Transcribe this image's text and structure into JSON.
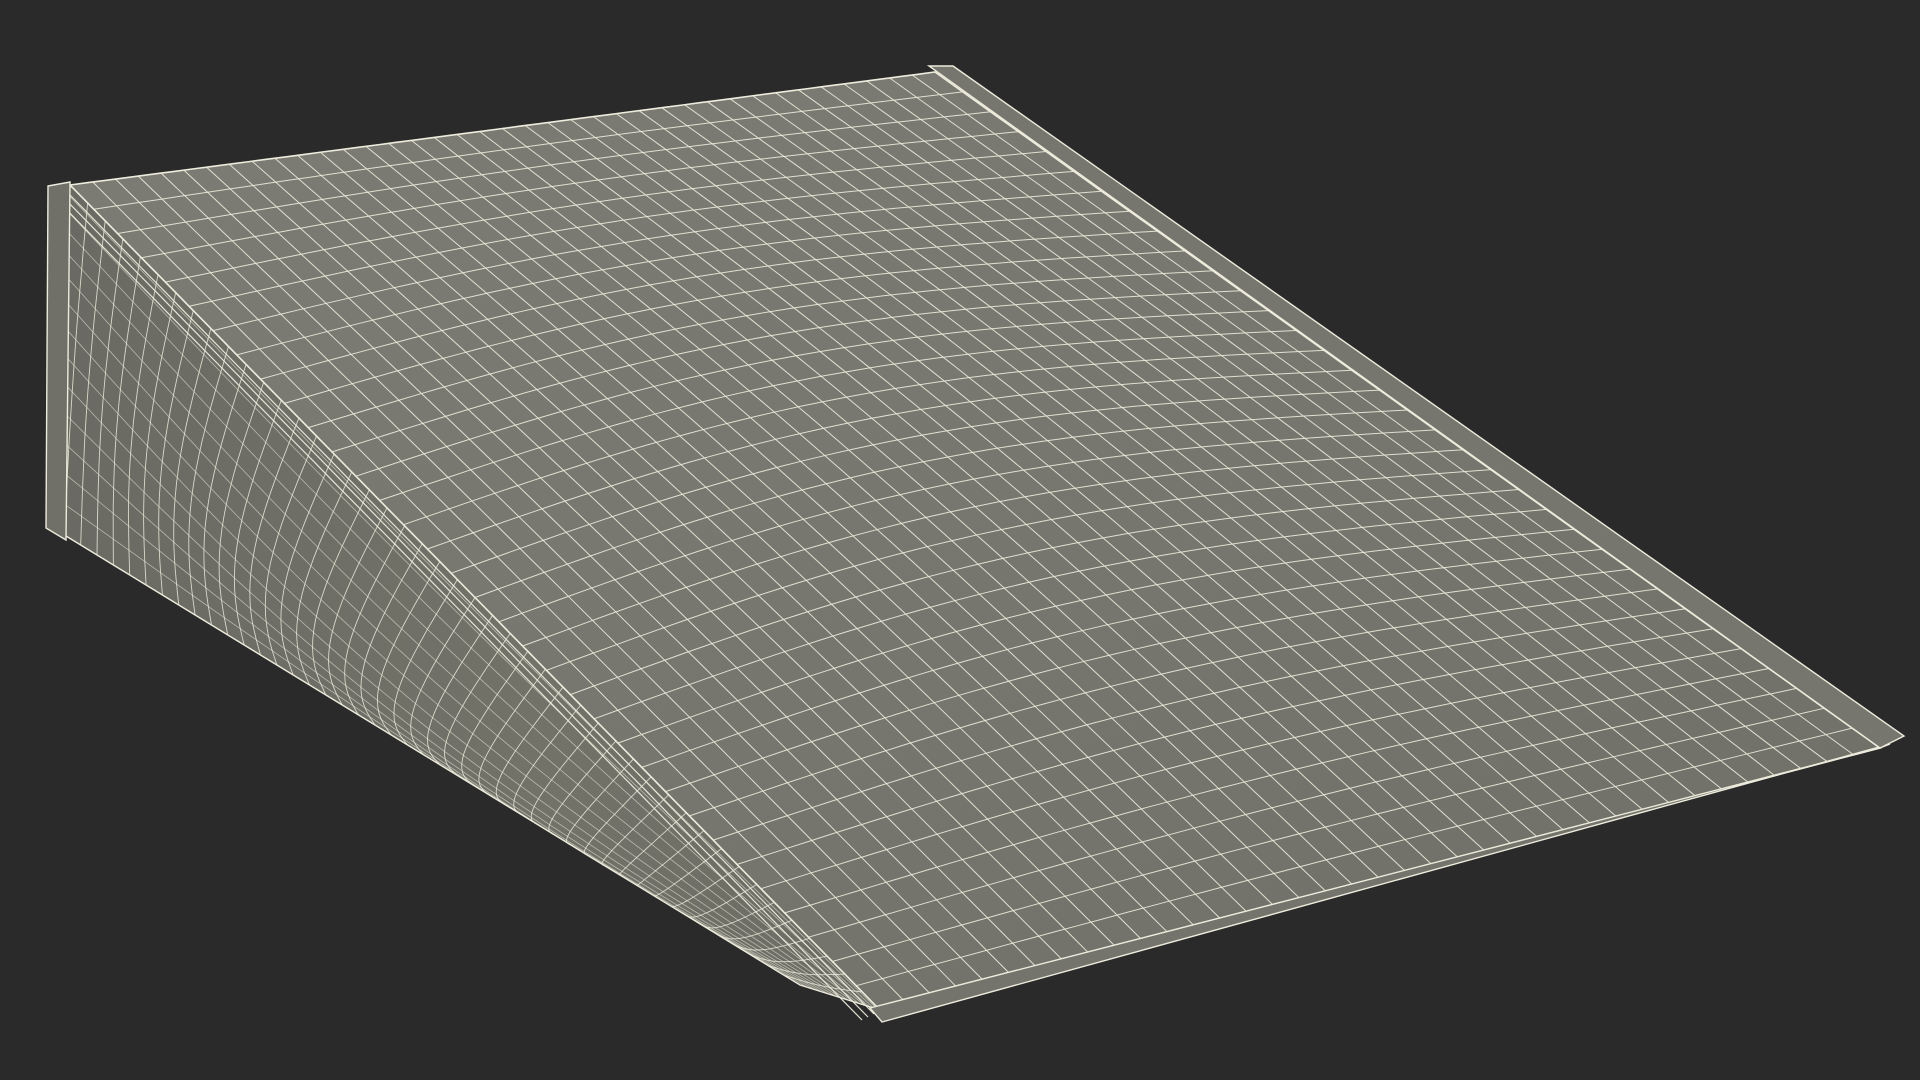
{
  "scene": {
    "background_color": "#2a2a2a",
    "surface_color": "#787870",
    "side_surface_color": "#6e6e66",
    "wire_color": "#ecebdc",
    "subject": "wireframe-bag-model"
  }
}
